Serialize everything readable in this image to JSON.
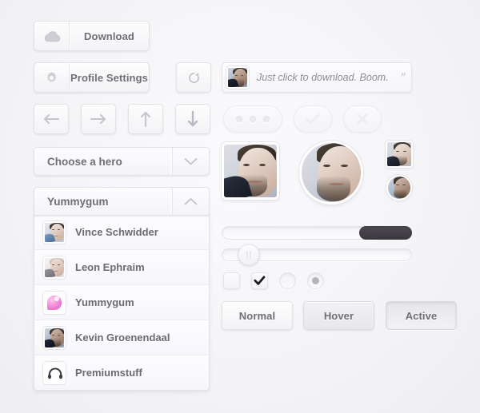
{
  "theme": {
    "background": "#f4f3f5",
    "surface": "#fbfafc",
    "border": "#e3e2e6",
    "text": "#6f6e77",
    "text_muted": "#8d8c95",
    "slider_fill": "#3f3d43",
    "accent_pink": "#e05cc1"
  },
  "download": {
    "label": "Download",
    "icon": "cloud-icon"
  },
  "profile_settings": {
    "label": "Profile Settings",
    "icon": "gear-icon"
  },
  "refresh": {
    "icon": "refresh-icon"
  },
  "arrows": [
    {
      "name": "arrow-left",
      "icon": "arrow-left-icon"
    },
    {
      "name": "arrow-right",
      "icon": "arrow-right-icon"
    },
    {
      "name": "arrow-up",
      "icon": "arrow-up-icon"
    },
    {
      "name": "arrow-down",
      "icon": "arrow-down-icon"
    }
  ],
  "quote": {
    "text": "Just click to download. Boom.",
    "quote_mark": "”",
    "avatar": "user-avatar"
  },
  "pills": [
    {
      "name": "more-options",
      "icon": "three-dots-icon",
      "label": ""
    },
    {
      "name": "confirm",
      "icon": "check-icon",
      "label": ""
    },
    {
      "name": "cancel",
      "icon": "close-icon",
      "label": ""
    }
  ],
  "select_hero": {
    "value": "Choose a hero",
    "expanded": false,
    "arrow_icon": "chevron-down-icon"
  },
  "select_yummygum": {
    "value": "Yummygum",
    "expanded": true,
    "arrow_icon": "chevron-up-icon"
  },
  "dropdown_items": [
    {
      "label": "Vince Schwidder",
      "avatar": "photo-avatar"
    },
    {
      "label": "Leon Ephraim",
      "avatar": "photo-avatar"
    },
    {
      "label": "Yummygum",
      "avatar": "gum-logo-icon"
    },
    {
      "label": "Kevin Groenendaal",
      "avatar": "photo-avatar"
    },
    {
      "label": "Premiumstuff",
      "avatar": "headphones-icon"
    }
  ],
  "photos": [
    {
      "name": "photo-square-large",
      "shape": "rounded-square"
    },
    {
      "name": "photo-circle-large",
      "shape": "circle"
    },
    {
      "name": "photo-square-small",
      "shape": "rounded-square"
    },
    {
      "name": "photo-circle-small",
      "shape": "circle"
    }
  ],
  "slider_one": {
    "fill_percent": 72,
    "value": 72,
    "min": 0,
    "max": 100
  },
  "slider_two": {
    "handle_percent": 14,
    "value": 14,
    "min": 0,
    "max": 100
  },
  "toggles": [
    {
      "name": "checkbox-unchecked",
      "type": "checkbox",
      "checked": false
    },
    {
      "name": "checkbox-checked",
      "type": "checkbox",
      "checked": true
    },
    {
      "name": "radio-unselected",
      "type": "radio",
      "checked": false
    },
    {
      "name": "radio-selected",
      "type": "radio",
      "checked": true
    }
  ],
  "state_buttons": {
    "normal": "Normal",
    "hover": "Hover",
    "active": "Active"
  }
}
